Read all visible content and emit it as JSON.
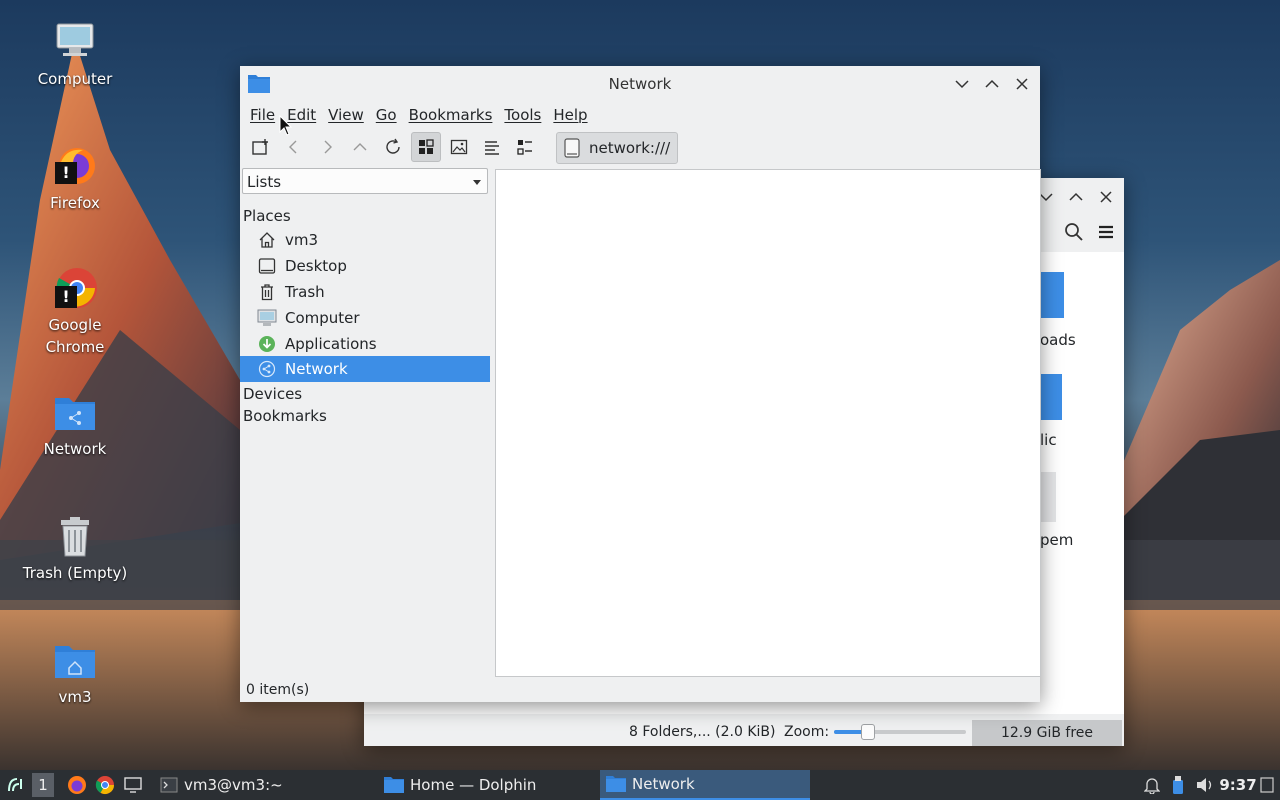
{
  "desktop": {
    "icons": [
      {
        "label": "Computer",
        "icon": "computer-icon"
      },
      {
        "label": "Firefox",
        "icon": "firefox-icon"
      },
      {
        "label": "Google Chrome",
        "icon": "chrome-icon"
      },
      {
        "label": "Network",
        "icon": "network-folder-icon"
      },
      {
        "label": "Trash (Empty)",
        "icon": "trash-icon"
      },
      {
        "label": "vm3",
        "icon": "home-folder-icon"
      }
    ],
    "warning_badge": "!"
  },
  "back_window": {
    "title": "Home — Dolphin",
    "partial_labels": [
      "oads",
      "lic",
      "pem"
    ],
    "status_text": "8 Folders,... (2.0 KiB)",
    "zoom_label": "Zoom:",
    "zoom_level": 0.25,
    "free_space": "12.9 GiB free"
  },
  "window": {
    "title": "Network",
    "menu": [
      "File",
      "Edit",
      "View",
      "Go",
      "Bookmarks",
      "Tools",
      "Help"
    ],
    "location": "network:///",
    "panel_select": "Lists",
    "places_header": "Places",
    "places": [
      {
        "label": "vm3",
        "icon": "home-icon"
      },
      {
        "label": "Desktop",
        "icon": "desktop-icon"
      },
      {
        "label": "Trash",
        "icon": "trash-icon"
      },
      {
        "label": "Computer",
        "icon": "computer-icon"
      },
      {
        "label": "Applications",
        "icon": "applications-icon"
      },
      {
        "label": "Network",
        "icon": "network-icon",
        "selected": true
      }
    ],
    "devices_header": "Devices",
    "bookmarks_header": "Bookmarks",
    "status": "0 item(s)"
  },
  "taskbar": {
    "workspace": "1",
    "terminal": "vm3@vm3:~",
    "tasks": [
      "Home — Dolphin",
      "Network"
    ],
    "clock": "9:37"
  },
  "colors": {
    "selection": "#3d8ee6",
    "taskbar": "#2b2f33",
    "folder_blue": "#3d8ee6"
  }
}
